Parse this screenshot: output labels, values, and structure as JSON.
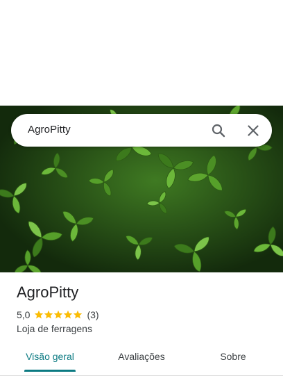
{
  "search": {
    "query": "AgroPitty"
  },
  "place": {
    "name": "AgroPitty",
    "rating": "5,0",
    "stars": 5,
    "review_count": "(3)",
    "category": "Loja de ferragens"
  },
  "tabs": [
    {
      "label": "Visão geral",
      "active": true
    },
    {
      "label": "Avaliações",
      "active": false
    },
    {
      "label": "Sobre",
      "active": false
    }
  ],
  "colors": {
    "accent": "#0b7a82",
    "star": "#fbbc04",
    "text": "#202124"
  }
}
